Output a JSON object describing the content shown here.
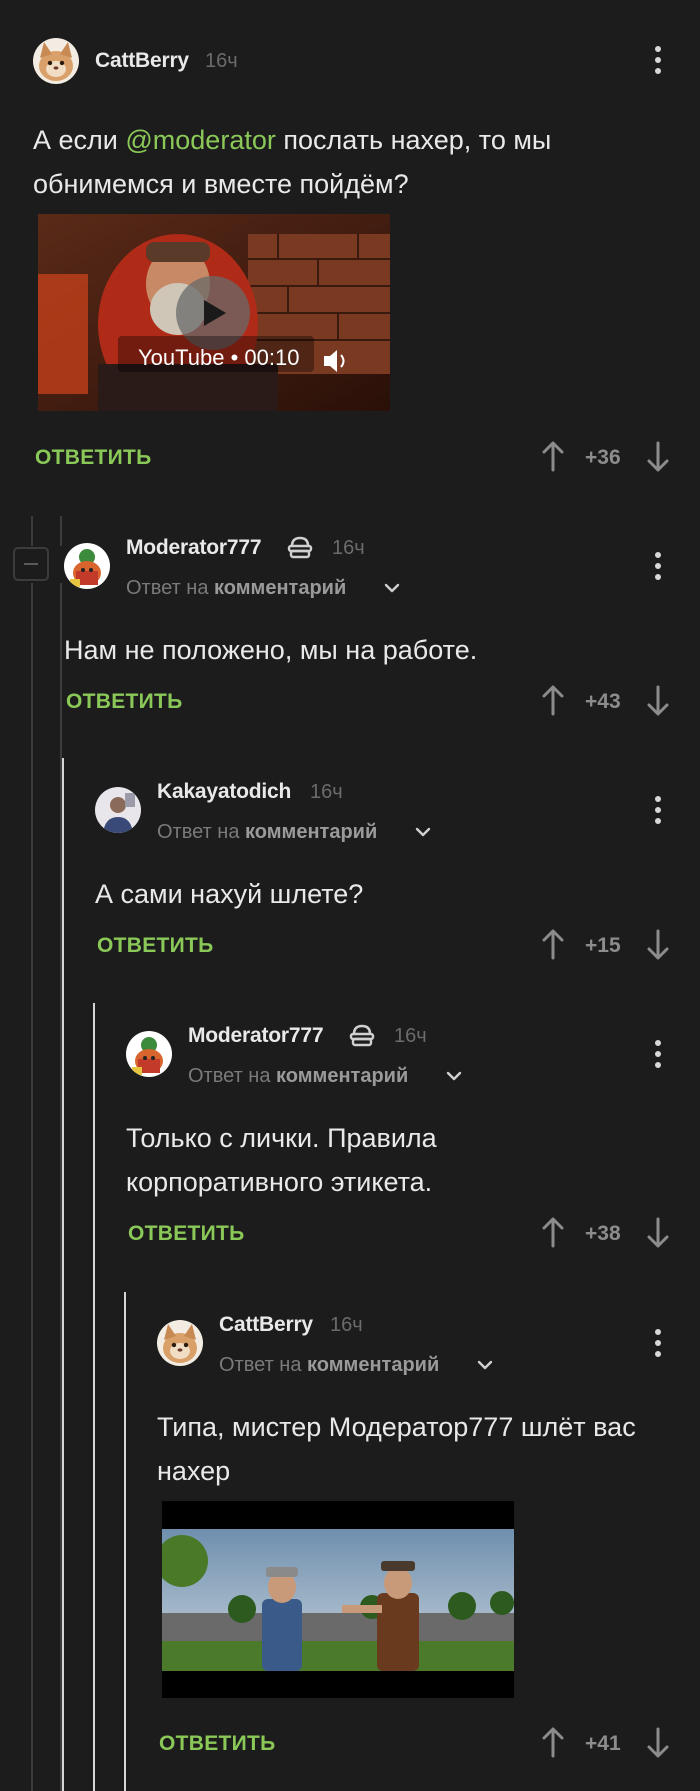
{
  "comments": [
    {
      "user": "CattBerry",
      "time": "16ч",
      "text_before": "А если ",
      "mention": "@moderator",
      "text_after": " послать нахер, то мы обнимемся и вместе пойдём?",
      "video": {
        "label": "YouTube • 00:10"
      },
      "reply": "ОТВЕТИТЬ",
      "score": "+36"
    },
    {
      "user": "Moderator777",
      "time": "16ч",
      "reply_to_prefix": "Ответ на",
      "reply_to_link": "комментарий",
      "text": "Нам не положено, мы на работе.",
      "reply": "ОТВЕТИТЬ",
      "score": "+43"
    },
    {
      "user": "Kakayatodich",
      "time": "16ч",
      "reply_to_prefix": "Ответ на",
      "reply_to_link": "комментарий",
      "text": "А сами нахуй шлете?",
      "reply": "ОТВЕТИТЬ",
      "score": "+15"
    },
    {
      "user": "Moderator777",
      "time": "16ч",
      "reply_to_prefix": "Ответ на",
      "reply_to_link": "комментарий",
      "text": "Только с лички. Правила корпоративного этикета.",
      "reply": "ОТВЕТИТЬ",
      "score": "+38"
    },
    {
      "user": "CattBerry",
      "time": "16ч",
      "reply_to_prefix": "Ответ на",
      "reply_to_link": "комментарий",
      "text": "Типа, мистер Модератор777 шлёт вас нахер",
      "reply": "ОТВЕТИТЬ",
      "score": "+41"
    }
  ],
  "icons": [
    "avatar-cat",
    "avatar-mod",
    "avatar-person",
    "kebab-menu-icon",
    "arrow-up-icon",
    "arrow-down-icon",
    "chevron-down-icon",
    "moderator-badge-icon",
    "collapse-icon",
    "play-icon",
    "volume-icon"
  ],
  "colors": {
    "accent": "#8ac858",
    "background": "#1c1c1c"
  }
}
